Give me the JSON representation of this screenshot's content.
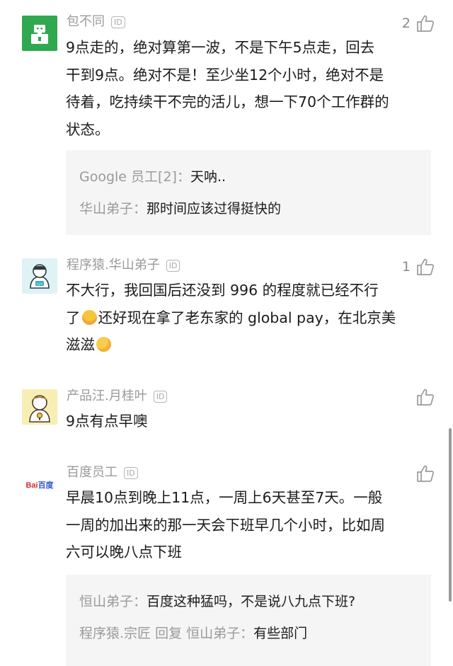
{
  "comments": [
    {
      "username": "包不同",
      "id_badge": "ID",
      "likes": "2",
      "avatar_color": "#2fa84f",
      "lines": [
        "9点走的，绝对算第一波，不是下午5点走，回去",
        "干到9点。绝对不是！至少坐12个小时，绝对不是",
        "待着，吃持续干不完的活儿，想一下70个工作群的",
        "状态。"
      ],
      "replies": [
        {
          "author": "Google 员工[2]：",
          "text": "天呐.."
        },
        {
          "author": "华山弟子：",
          "text": "那时间应该过得挺快的"
        }
      ]
    },
    {
      "username": "程序猿.华山弟子",
      "id_badge": "ID",
      "likes": "1",
      "avatar_color": "#dff3f7",
      "lines": [
        "不大行，我回国后还没到 996 的程度就已经不行",
        "了",
        "还好现在拿了老东家的 global pay，在北京美",
        "滋滋"
      ]
    },
    {
      "username": "产品汪.月桂叶",
      "id_badge": "ID",
      "likes": "",
      "avatar_color": "#f8eeb5",
      "lines": [
        "9点有点早噢"
      ]
    },
    {
      "username": "百度员工",
      "id_badge": "ID",
      "likes": "",
      "avatar_text": "Bai百度",
      "lines": [
        "早晨10点到晚上11点，一周上6天甚至7天。一般",
        "一周的加出来的那一天会下班早几个小时，比如周",
        "六可以晚八点下班"
      ],
      "replies": [
        {
          "author": "恒山弟子：",
          "text": "百度这种猛吗，不是说八九点下班?"
        },
        {
          "author": "程序猿.宗匠 回复 恒山弟子：",
          "text": "有些部门"
        }
      ]
    }
  ],
  "colors": {
    "username": "#9a9a9a",
    "body": "#1b1b1b",
    "reply_bg": "#f5f5f6",
    "baidu_red": "#d7282d",
    "baidu_blue": "#2a57d4"
  }
}
